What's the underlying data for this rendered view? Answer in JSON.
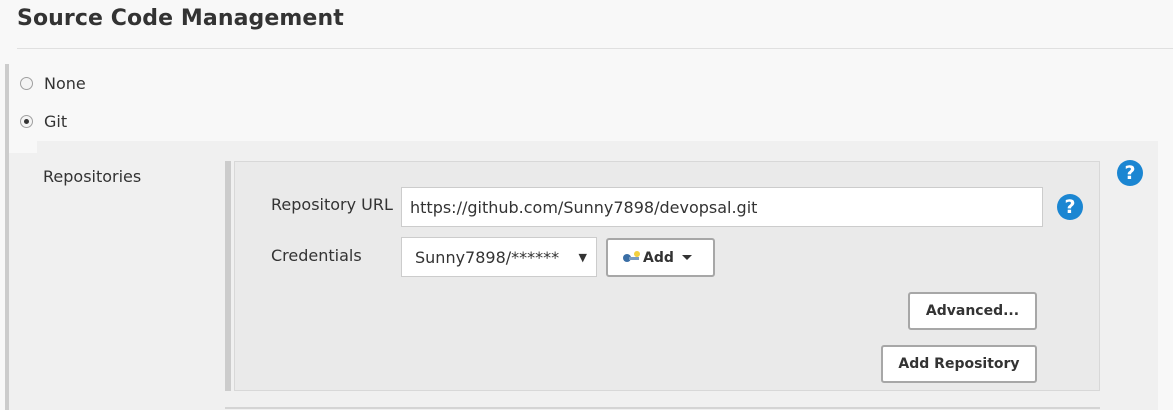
{
  "section": {
    "title": "Source Code Management"
  },
  "scm_options": [
    {
      "label": "None",
      "selected": false
    },
    {
      "label": "Git",
      "selected": true
    }
  ],
  "git": {
    "repositories_label": "Repositories",
    "repository_url_label": "Repository URL",
    "repository_url_value": "https://github.com/Sunny7898/devopsal.git",
    "credentials_label": "Credentials",
    "credentials_selected": "Sunny7898/******",
    "add_button_label": "Add",
    "advanced_button_label": "Advanced...",
    "add_repository_button_label": "Add Repository"
  },
  "icons": {
    "help_glyph": "?",
    "select_arrow": "▼"
  },
  "colors": {
    "help_icon": "#1b86d2",
    "page_background": "#f8f8f8",
    "panel_background": "#eaeaea"
  }
}
